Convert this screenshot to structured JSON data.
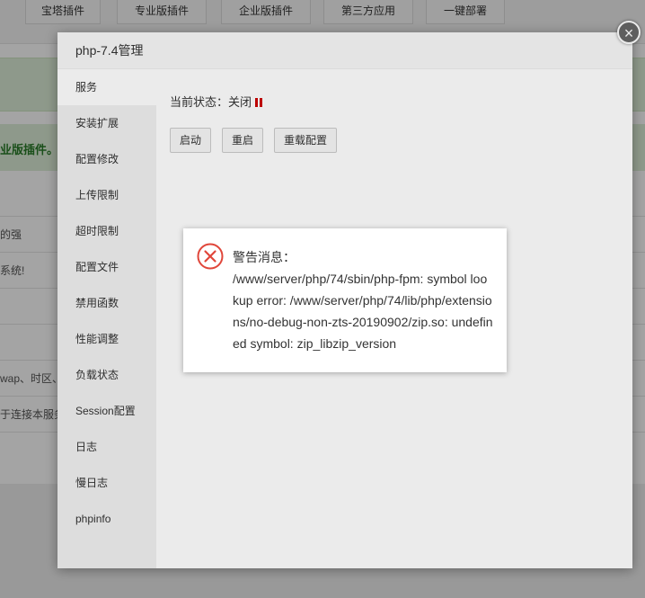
{
  "background": {
    "tabs": [
      "宝塔插件",
      "专业版插件",
      "企业版插件",
      "第三方应用",
      "一键部署"
    ],
    "green_text": "业版插件。",
    "rows": [
      "的强",
      "系统!",
      "",
      "",
      "wap、时区、",
      "于连接本服务"
    ]
  },
  "modal": {
    "title": "php-7.4管理",
    "close_icon": "×",
    "sidebar": [
      {
        "label": "服务"
      },
      {
        "label": "安装扩展"
      },
      {
        "label": "配置修改"
      },
      {
        "label": "上传限制"
      },
      {
        "label": "超时限制"
      },
      {
        "label": "配置文件"
      },
      {
        "label": "禁用函数"
      },
      {
        "label": "性能调整"
      },
      {
        "label": "负载状态"
      },
      {
        "label": "Session配置"
      },
      {
        "label": "日志"
      },
      {
        "label": "慢日志"
      },
      {
        "label": "phpinfo"
      }
    ],
    "status_label": "当前状态：关闭",
    "buttons": {
      "start": "启动",
      "restart": "重启",
      "reload": "重载配置"
    }
  },
  "alert": {
    "icon": "error-circle-icon",
    "title": "警告消息：",
    "message": "/www/server/php/74/sbin/php-fpm: symbol lookup error: /www/server/php/74/lib/php/extensions/no-debug-non-zts-20190902/zip.so: undefined symbol: zip_libzip_version"
  },
  "colors": {
    "status_off": "#cc0000",
    "error_icon": "#e0463a",
    "banner_green": "#dff0d8"
  }
}
